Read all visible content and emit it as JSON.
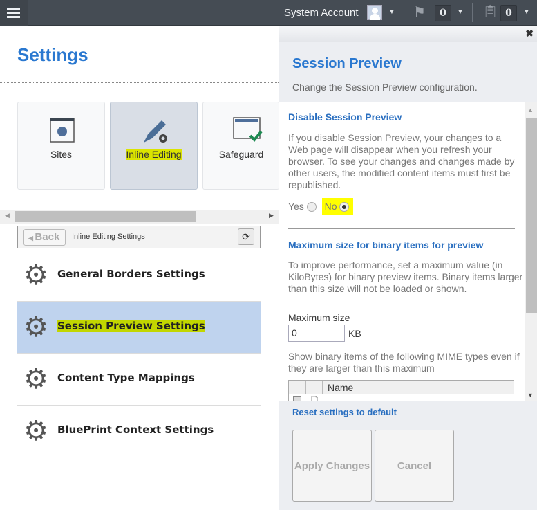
{
  "topbar": {
    "account_name": "System Account",
    "flag_count": "0",
    "tasks_count": "0"
  },
  "left": {
    "title": "Settings",
    "tiles": [
      {
        "label": "Sites",
        "icon": "browser-globe-icon"
      },
      {
        "label": "Inline Editing",
        "icon": "pencil-gear-icon",
        "selected": true
      },
      {
        "label": "Safeguard",
        "icon": "window-check-icon"
      }
    ],
    "toolbar": {
      "back_label": "Back",
      "breadcrumb": "Inline Editing Settings"
    },
    "items": [
      {
        "label": "General Borders Settings"
      },
      {
        "label": "Session Preview Settings",
        "selected": true
      },
      {
        "label": "Content Type Mappings"
      },
      {
        "label": "BluePrint Context Settings"
      }
    ]
  },
  "panel": {
    "title": "Session Preview",
    "subtitle": "Change the Session Preview configuration.",
    "section1": {
      "heading": "Disable Session Preview",
      "text": "If you disable Session Preview, your changes to a Web page will disappear when you refresh your browser. To see your changes and changes made by other users, the modified content items must first be republished.",
      "yes_label": "Yes",
      "no_label": "No",
      "selected": "No"
    },
    "section2": {
      "heading": "Maximum size for binary items for preview",
      "text": "To improve performance, set a maximum value (in KiloBytes) for binary preview items. Binary items larger than this size will not be loaded or shown.",
      "max_size_label": "Maximum size",
      "max_size_value": "0",
      "unit": "KB",
      "mime_text": "Show binary items of the following MIME types even if they are larger than this maximum",
      "grid_header_name": "Name"
    },
    "reset_label": "Reset settings to default",
    "apply_label": "Apply Changes",
    "cancel_label": "Cancel"
  }
}
